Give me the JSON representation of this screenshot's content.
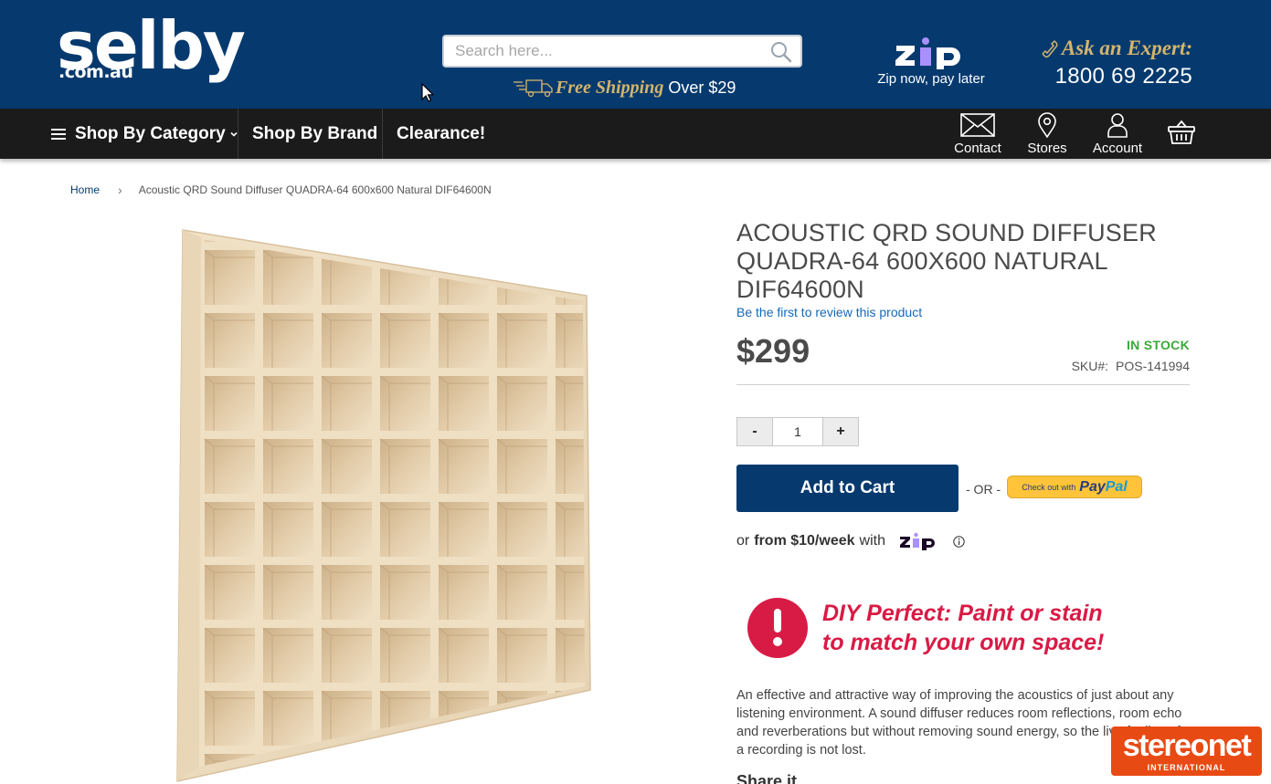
{
  "header": {
    "logo_word": "selby",
    "logo_domain": ".com.au",
    "search_placeholder": "Search here...",
    "free_shipping": "Free Shipping",
    "free_shipping_rest": "Over $29",
    "zip_tagline": "Zip now, pay later",
    "expert_label": "Ask an Expert:",
    "phone": "1800 69 2225",
    "colors": {
      "header_bg": "#063a6e",
      "gold": "#d3b46c",
      "zip_purple": "#aa8fff"
    }
  },
  "nav": {
    "shop_by_category": "Shop By Category",
    "shop_by_brand": "Shop By Brand",
    "clearance": "Clearance!",
    "contact": "Contact",
    "stores": "Stores",
    "account": "Account"
  },
  "breadcrumb": {
    "home": "Home",
    "current": "Acoustic QRD Sound Diffuser QUADRA-64 600x600 Natural DIF64600N"
  },
  "product": {
    "title": "ACOUSTIC QRD SOUND DIFFUSER QUADRA-64 600X600 NATURAL DIF64600N",
    "review_link": "Be the first to review this product",
    "price": "$299",
    "stock": "IN STOCK",
    "sku_label": "SKU#:",
    "sku_value": "POS-141994",
    "qty_minus": "-",
    "qty_value": "1",
    "qty_plus": "+",
    "add_to_cart": "Add to Cart",
    "or_text": "- OR -",
    "paypal_checkout": "Check out with",
    "paypal_pay": "Pay",
    "paypal_pal": "Pal",
    "zip_prefix": "or",
    "zip_amount": "from $10/week",
    "zip_with": "with",
    "diy_line1": "DIY Perfect: Paint or stain",
    "diy_line2": "to match your own space!",
    "description": "An effective and attractive way of improving the acoustics of just about any listening environment. A sound diffuser reduces room reflections, room echo and reverberations but without removing sound energy, so the live feeling of a recording is not lost.",
    "share": "Share it",
    "colors": {
      "accent_red": "#d81b45",
      "stock_green": "#3aa93a",
      "link_blue": "#1468b8"
    }
  },
  "watermark": {
    "title": "stereonet",
    "subtitle": "INTERNATIONAL"
  }
}
